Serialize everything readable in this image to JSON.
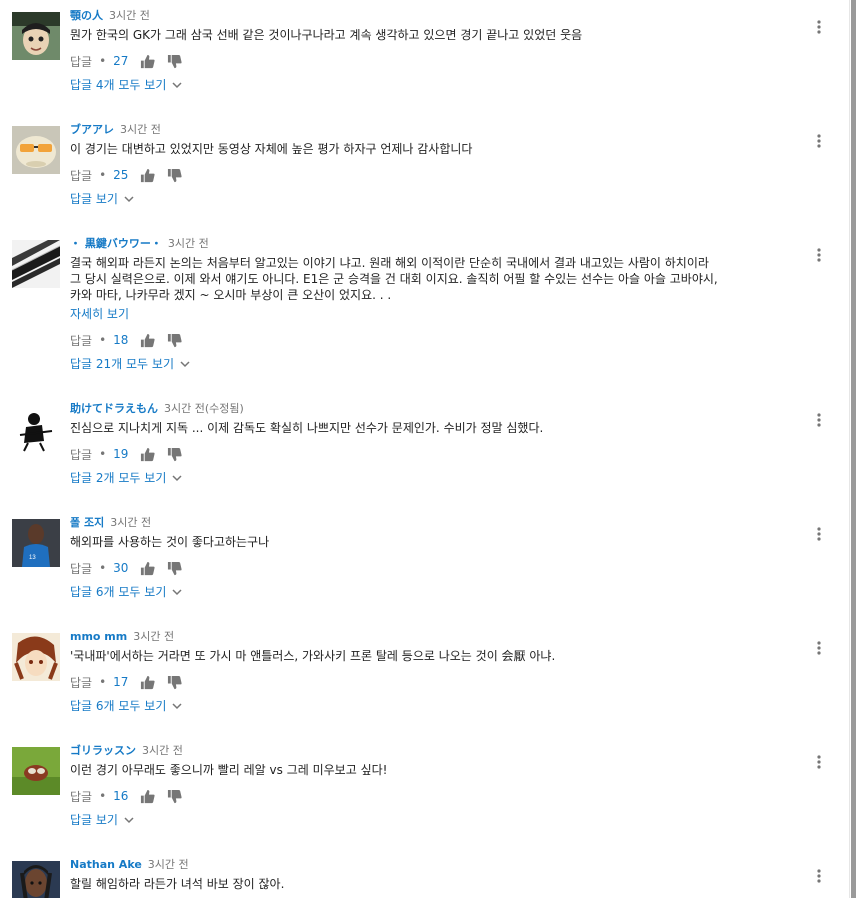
{
  "labels": {
    "reply": "답글",
    "dot": "•",
    "read_more": "자세히 보기"
  },
  "colors": {
    "link": "#167ac6",
    "meta": "#767676",
    "text": "#222222"
  },
  "comments": [
    {
      "author": "顎の人",
      "time": "3시간 전",
      "text": "뭔가 한국의 GK가 그래 삼국 선배 같은 것이나구나라고 계속 생각하고 있으면 경기 끝나고 있었던 웃음",
      "text2": "",
      "likes": "27",
      "view_replies": "답글 4개 모두 보기"
    },
    {
      "author": "ブアアレ",
      "time": "3시간 전",
      "text": "이 경기는 대변하고 있었지만 동영상 자체에 높은 평가 하자구 언제나 감사합니다",
      "text2": "",
      "likes": "25",
      "view_replies": "답글 보기"
    },
    {
      "author": "・ 黒鍵バウワー・",
      "time": "3시간 전",
      "text": "결국 해외파 라든지 논의는 처음부터 알고있는 이야기 냐고. 원래 해외 이적이란 단순히 국내에서 결과 내고있는 사람이 하치이라",
      "text2": "그 당시 실력은으로. 이제 와서 얘기도 아니다. E1은 군 승격을 건 대회 이지요. 솔직히 어필 할 수있는 선수는 아슬 아슬 고바야시,",
      "text3": "카와 마타, 나카무라 겠지 ~ 오시마 부상이 큰 오산이 었지요. . .",
      "likes": "18",
      "view_replies": "답글 21개 모두 보기"
    },
    {
      "author": "助けてドラえもん",
      "time": "3시간 전(수정됨)",
      "text": "진심으로 지나치게 지독 ... 이제 감독도 확실히 나쁘지만 선수가 문제인가. 수비가 정말 심했다.",
      "text2": "",
      "likes": "19",
      "view_replies": "답글 2개 모두 보기"
    },
    {
      "author": "폴 조지",
      "time": "3시간 전",
      "text": "해외파를 사용하는 것이 좋다고하는구나",
      "text2": "",
      "likes": "30",
      "view_replies": "답글 6개 모두 보기"
    },
    {
      "author": "mmo mm",
      "time": "3시간 전",
      "text": "'국내파'에서하는 거라면 또 가시 마 앤틀러스, 가와사키 프론 탈레 등으로 나오는 것이 会厭 아냐.",
      "text2": "",
      "likes": "17",
      "view_replies": "답글 6개 모두 보기"
    },
    {
      "author": "ゴリラッスン",
      "time": "3시간 전",
      "text": "이런 경기 아무래도 좋으니까 빨리 레알 vs 그레 미우보고 싶다!",
      "text2": "",
      "likes": "16",
      "view_replies": "답글 보기"
    },
    {
      "author": "Nathan Ake",
      "time": "3시간 전",
      "text": "할릴 해임하라 라든가 녀석 바보 장이 잖아.",
      "text2": ""
    }
  ],
  "icons": [
    "thumbs-up-icon",
    "thumbs-down-icon",
    "chevron-down-icon",
    "more-vert-icon"
  ]
}
